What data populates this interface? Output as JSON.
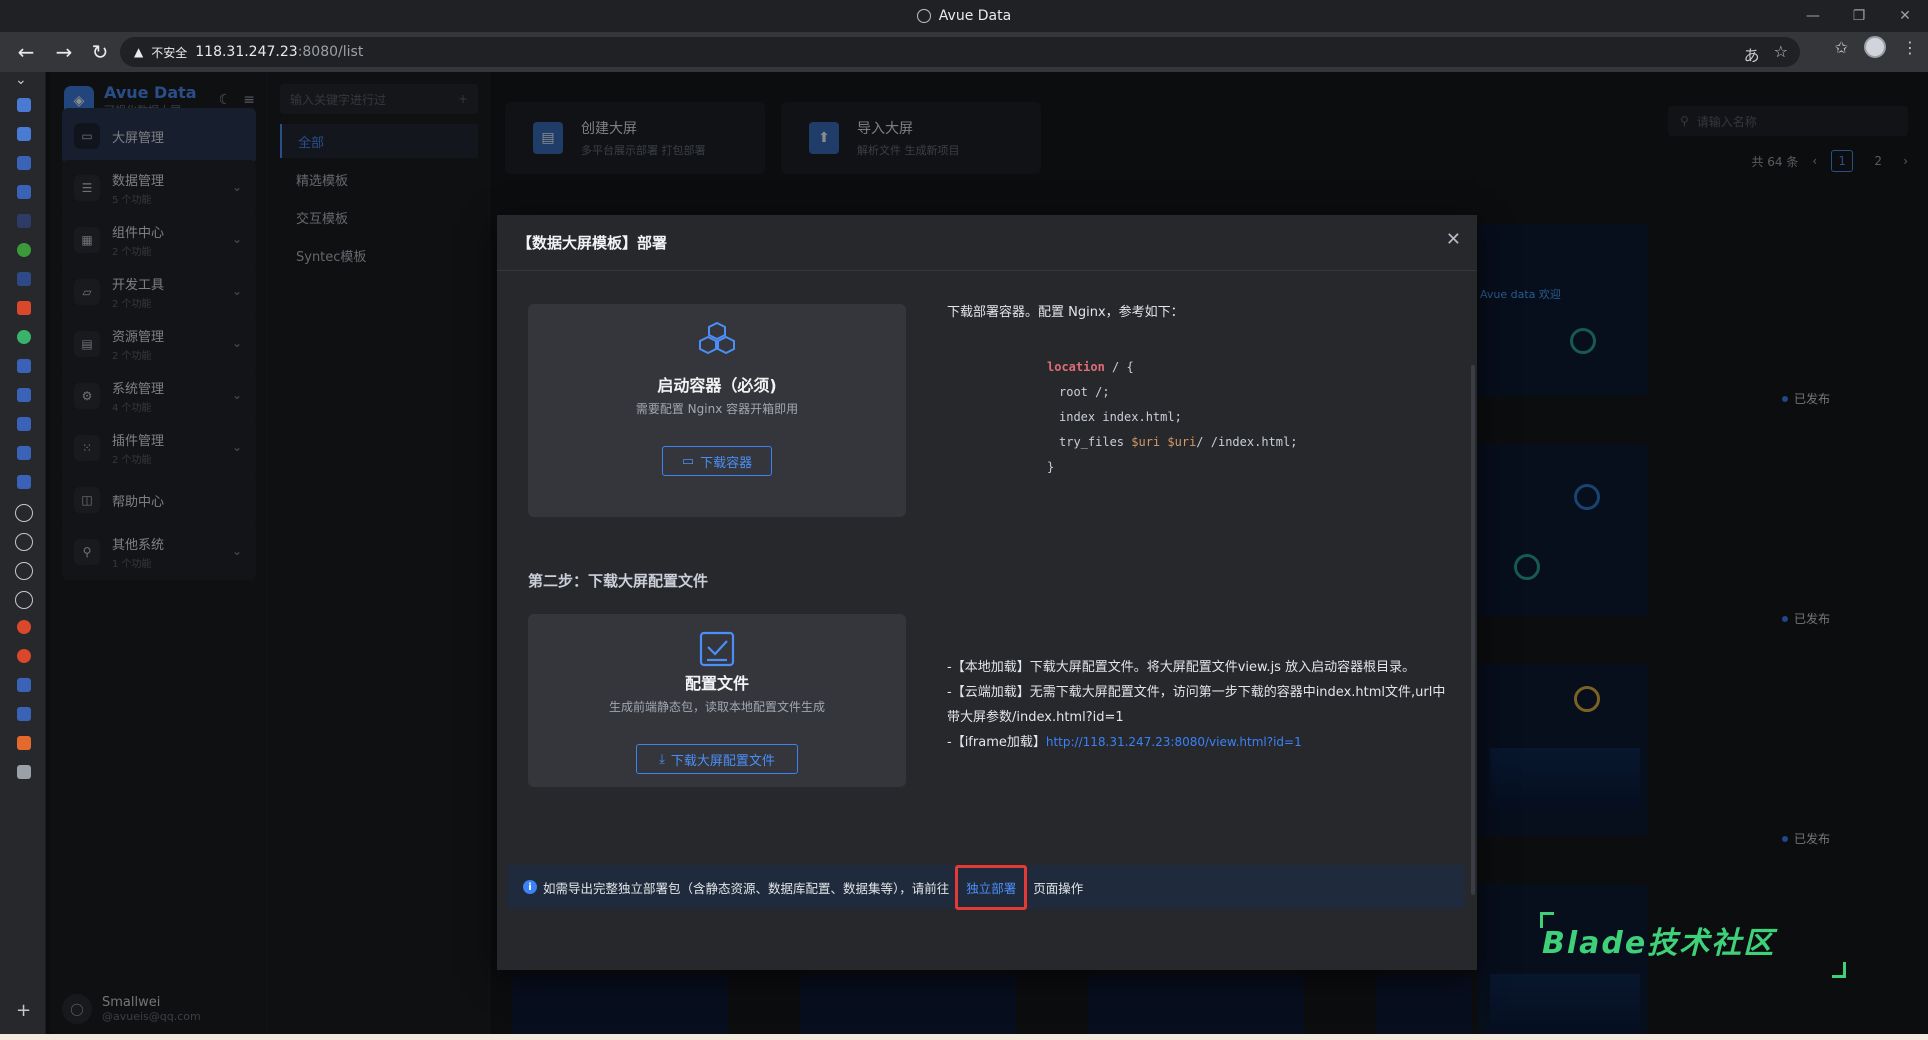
{
  "browser": {
    "window_title": "Avue Data",
    "insecure_label": "不安全",
    "url_host": "118.31.247.23",
    "url_path": ":8080/list"
  },
  "sidebar": {
    "brand": {
      "name": "Avue Data",
      "subtitle": "可视化数据大屏"
    },
    "menu": [
      {
        "label": "大屏管理",
        "count": ""
      },
      {
        "label": "数据管理",
        "count": "5 个功能"
      },
      {
        "label": "组件中心",
        "count": "2 个功能"
      },
      {
        "label": "开发工具",
        "count": "2 个功能"
      },
      {
        "label": "资源管理",
        "count": "2 个功能"
      },
      {
        "label": "系统管理",
        "count": "4 个功能"
      },
      {
        "label": "插件管理",
        "count": "2 个功能"
      },
      {
        "label": "帮助中心",
        "count": ""
      },
      {
        "label": "其他系统",
        "count": "1 个功能"
      }
    ],
    "user": {
      "name": "Smallwei",
      "email": "@avueis@qq.com"
    }
  },
  "categories": {
    "search_placeholder": "输入关键字进行过",
    "items": [
      "全部",
      "精选模板",
      "交互模板",
      "Syntec模板"
    ]
  },
  "main": {
    "create": {
      "title": "创建大屏",
      "desc": "多平台展示部署 打包部署"
    },
    "import": {
      "title": "导入大屏",
      "desc": "解析文件 生成新项目"
    },
    "search_placeholder": "请输入名称",
    "total": "共 64 条",
    "pages": [
      "1",
      "2"
    ],
    "thumb_text": "Avue data 欢迎",
    "published": "已发布"
  },
  "modal": {
    "title": "【数据大屏模板】部署",
    "step1": {
      "title": "启动容器（必须)",
      "desc": "需要配置 Nginx 容器开箱即用",
      "button": "下载容器"
    },
    "intro": "下载部署容器。配置 Nginx，参考如下：",
    "code": {
      "line1_kw": "location",
      "line1_rest": " / {",
      "line2": "root /;",
      "line3": "index index.html;",
      "line4_a": "try_files ",
      "line4_var1": "$uri",
      "line4_b": " ",
      "line4_var2": "$uri",
      "line4_c": "/ /index.html;",
      "line5": "}"
    },
    "step2_title": "第二步：下载大屏配置文件",
    "step2": {
      "title": "配置文件",
      "desc": "生成前端静态包，读取本地配置文件生成",
      "button": "下载大屏配置文件"
    },
    "notes": {
      "n1": "-【本地加载】下载大屏配置文件。将大屏配置文件view.js 放入启动容器根目录。",
      "n2": "-【云端加载】无需下载大屏配置文件，访问第一步下载的容器中index.html文件,url中带大屏参数/index.html?id=1",
      "n3_prefix": "-【iframe加载】",
      "n3_link": "http://118.31.247.23:8080/view.html?id=1"
    },
    "alert": {
      "prefix": "如需导出完整独立部署包（含静态资源、数据库配置、数据集等），请前往",
      "link": "独立部署",
      "suffix": "页面操作"
    }
  },
  "watermark": "Blade技术社区"
}
